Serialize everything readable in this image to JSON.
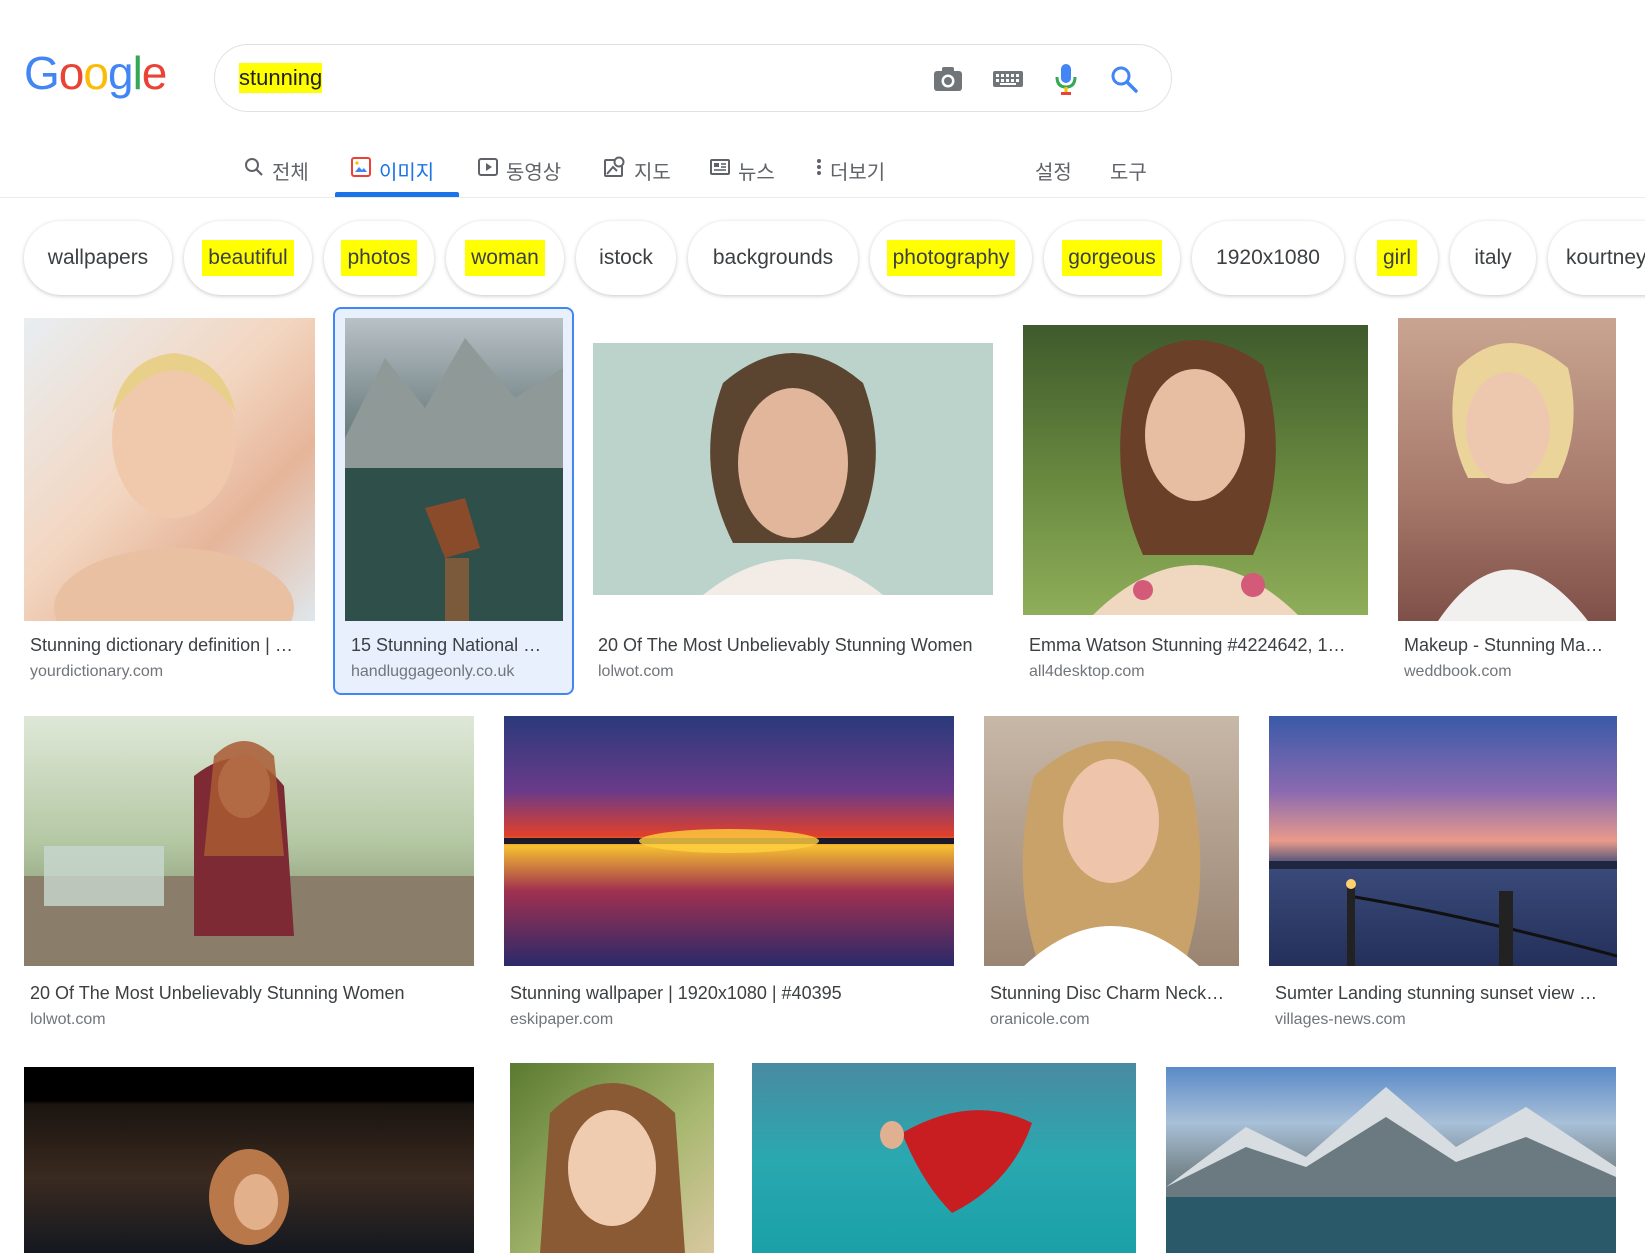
{
  "logo": {
    "letters": [
      "G",
      "o",
      "o",
      "g",
      "l",
      "e"
    ],
    "colors": [
      "#4285f4",
      "#ea4335",
      "#fbbc05",
      "#4285f4",
      "#34a853",
      "#ea4335"
    ]
  },
  "search": {
    "query": "stunning",
    "highlight": "#ffff00"
  },
  "search_icons": [
    "camera-icon",
    "keyboard-icon",
    "mic-icon",
    "search-icon"
  ],
  "tabs": [
    {
      "label": "전체",
      "icon": "search-icon"
    },
    {
      "label": "이미지",
      "icon": "image-icon",
      "active": true
    },
    {
      "label": "동영상",
      "icon": "video-icon"
    },
    {
      "label": "지도",
      "icon": "map-icon"
    },
    {
      "label": "뉴스",
      "icon": "news-icon"
    },
    {
      "label": "더보기",
      "icon": "more-icon"
    },
    {
      "label": "설정"
    },
    {
      "label": "도구"
    }
  ],
  "chips": [
    "wallpapers",
    "beautiful",
    "photos",
    "woman",
    "istock",
    "backgrounds",
    "photography",
    "gorgeous",
    "1920x1080",
    "girl",
    "italy",
    "kourtney"
  ],
  "results": [
    {
      "title": "Stunning dictionary definition | …",
      "source": "yourdictionary.com"
    },
    {
      "title": "15 Stunning National …",
      "source": "handluggageonly.co.uk",
      "selected": true
    },
    {
      "title": "20 Of The Most Unbelievably Stunning Women",
      "source": "lolwot.com"
    },
    {
      "title": "Emma Watson Stunning #4224642, 1…",
      "source": "all4desktop.com"
    },
    {
      "title": "Makeup - Stunning Ma…",
      "source": "weddbook.com"
    },
    {
      "title": "20 Of The Most Unbelievably Stunning Women",
      "source": "lolwot.com"
    },
    {
      "title": "Stunning wallpaper | 1920x1080 | #40395",
      "source": "eskipaper.com"
    },
    {
      "title": "Stunning Disc Charm Neck…",
      "source": "oranicole.com"
    },
    {
      "title": "Sumter Landing stunning sunset view …",
      "source": "villages-news.com"
    }
  ],
  "colors": {
    "accent": "#1a73e8",
    "selected_border": "#4285f4",
    "selected_bg": "#e8f0fe"
  }
}
